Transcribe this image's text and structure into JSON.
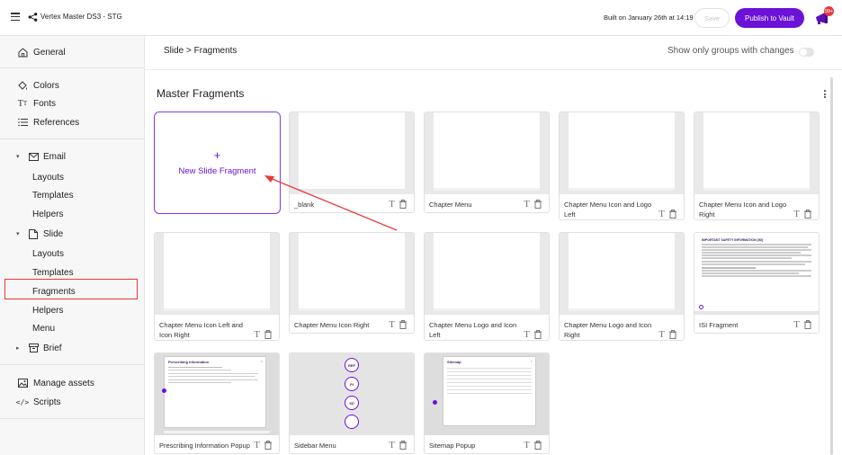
{
  "header": {
    "app_title": "Vertex Master DS3 - STG",
    "built_text": "Built on January 26th at 14:19",
    "save_label": "Save",
    "publish_label": "Publish to Vault",
    "notification_count": "99+"
  },
  "sidebar": {
    "general": "General",
    "colors": "Colors",
    "fonts": "Fonts",
    "references": "References",
    "email": "Email",
    "email_children": [
      "Layouts",
      "Templates",
      "Helpers"
    ],
    "slide": "Slide",
    "slide_children": [
      "Layouts",
      "Templates",
      "Fragments",
      "Helpers",
      "Menu"
    ],
    "brief": "Brief",
    "manage_assets": "Manage assets",
    "scripts": "Scripts"
  },
  "main": {
    "breadcrumb": "Slide > Fragments",
    "toggle_label": "Show only groups with changes",
    "section_title": "Master Fragments",
    "new_fragment_label": "New Slide Fragment",
    "cards": [
      "_blank",
      "Chapter Menu",
      "Chapter Menu Icon and Logo Left",
      "Chapter Menu Icon and Logo Right",
      "Chapter Menu Icon Left and Icon Right",
      "Chapter Menu Icon Right",
      "Chapter Menu Logo and Icon Left",
      "Chapter Menu Logo and Icon Right",
      "ISI Fragment",
      "Prescribing Information Popup",
      "Sidebar Menu",
      "Sitemap Popup"
    ],
    "thumb_texts": {
      "isi_title": "IMPORTANT SAFETY INFORMATION (ISI)",
      "pi_title": "Prescribing information",
      "sitemap_title": "Sitemap",
      "sidebar_buttons": [
        "REF",
        "PI",
        "SD"
      ]
    }
  },
  "colors": {
    "accent": "#6b11d8",
    "highlight": "#e53935",
    "badge": "#e53945"
  },
  "icons": {
    "menu": "hamburger-icon",
    "share": "share-icon",
    "notifications": "megaphone-icon",
    "card_rename": "text-t-icon",
    "card_delete": "trash-icon"
  }
}
